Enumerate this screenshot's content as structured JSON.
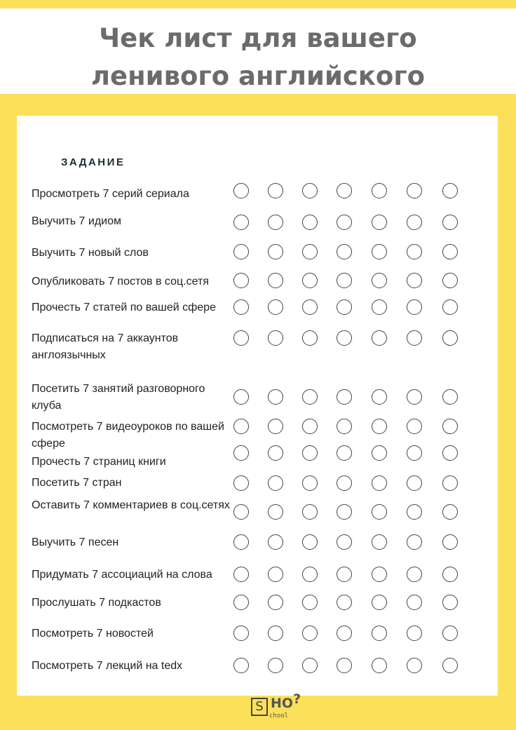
{
  "header": {
    "title_line1": "Чек лист для вашего",
    "title_line2": "ленивого английского"
  },
  "section_label": "ЗАДАНИЕ",
  "tasks": [
    {
      "label": "Просмотреть 7 серий  сериала",
      "checked": [
        false,
        false,
        false,
        false,
        false,
        false,
        false
      ]
    },
    {
      "label": "Выучить 7 идиом",
      "checked": [
        false,
        false,
        false,
        false,
        false,
        false,
        false
      ]
    },
    {
      "label": "Выучить 7 новый слов",
      "checked": [
        false,
        false,
        false,
        false,
        false,
        false,
        false
      ]
    },
    {
      "label": "Опубликовать 7 постов в соц.сетя",
      "checked": [
        false,
        false,
        false,
        false,
        false,
        false,
        false
      ]
    },
    {
      "label": "Прочесть 7 статей по вашей сфере",
      "checked": [
        false,
        false,
        false,
        false,
        false,
        false,
        false
      ]
    },
    {
      "label": "Подписаться на 7 аккаунтов англоязычных",
      "checked": [
        false,
        false,
        false,
        false,
        false,
        false,
        false
      ]
    },
    {
      "label": "Посетить 7 занятий разговорного клуба",
      "checked": [
        false,
        false,
        false,
        false,
        false,
        false,
        false
      ]
    },
    {
      "label": "Посмотреть 7 видеоуроков по вашей сфере",
      "checked": [
        false,
        false,
        false,
        false,
        false,
        false,
        false
      ]
    },
    {
      "label": "Прочесть 7 страниц книги",
      "checked": [
        false,
        false,
        false,
        false,
        false,
        false,
        false
      ]
    },
    {
      "label": "Посетить 7 стран",
      "checked": [
        false,
        false,
        false,
        false,
        false,
        false,
        false
      ]
    },
    {
      "label": "Оставить 7 комментариев в соц.сетях",
      "checked": [
        false,
        false,
        false,
        false,
        false,
        false,
        false
      ]
    },
    {
      "label": "Выучить 7 песен",
      "checked": [
        false,
        false,
        false,
        false,
        false,
        false,
        false
      ]
    },
    {
      "label": "Придумать 7 ассоциаций на слова",
      "checked": [
        false,
        false,
        false,
        false,
        false,
        false,
        false
      ]
    },
    {
      "label": "Прослушать 7 подкастов",
      "checked": [
        false,
        false,
        false,
        false,
        false,
        false,
        false
      ]
    },
    {
      "label": "Посмотреть 7 новостей",
      "checked": [
        false,
        false,
        false,
        false,
        false,
        false,
        false
      ]
    },
    {
      "label": "Посмотреть 7 лекций на tedx",
      "checked": [
        false,
        false,
        false,
        false,
        false,
        false,
        false
      ]
    }
  ],
  "logo": {
    "box_letter": "S",
    "ho": "HO",
    "question": "?",
    "sub": "chool"
  },
  "colors": {
    "background": "#fbe05a",
    "title": "#6b6b6b",
    "circle_stroke": "#444444"
  }
}
